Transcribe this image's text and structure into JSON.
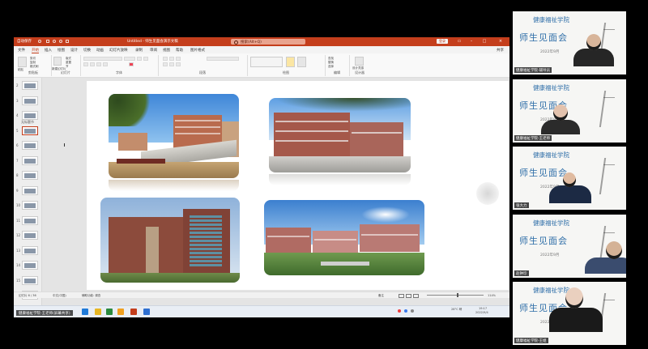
{
  "window": {
    "title_left": "自动保存",
    "doc_title": "Untitled - 师生见面会演示文稿",
    "search_placeholder": "搜索(Alt+Q)",
    "login": "登录",
    "share": "共享"
  },
  "tabs": [
    "文件",
    "开始",
    "插入",
    "绘图",
    "设计",
    "切换",
    "动画",
    "幻灯片放映",
    "录制",
    "审阅",
    "视图",
    "帮助",
    "图片格式"
  ],
  "active_tab": 1,
  "ribbon": {
    "groups": [
      "剪贴板",
      "幻灯片",
      "字体",
      "段落",
      "绘图",
      "编辑",
      "设计器"
    ],
    "clipboard": {
      "paste": "粘贴",
      "cut": "剪切",
      "copy": "复制",
      "format_painter": "格式刷"
    },
    "slides": {
      "new_slide": "新建幻灯片",
      "layout": "版式",
      "reset": "重置",
      "section": "节"
    },
    "editing": {
      "find": "查找",
      "replace": "替换",
      "select": "选择"
    },
    "designer": {
      "design_ideas": "设计灵感"
    }
  },
  "thumbnails": {
    "numbers": [
      "2",
      "3",
      "4",
      "5",
      "6",
      "7",
      "8",
      "9",
      "10",
      "11",
      "12",
      "13",
      "14",
      "15",
      "16"
    ],
    "section_label": "无标题节",
    "selected_index": 3
  },
  "status": {
    "slide_info": "幻灯片 6 / 36",
    "language": "中文(中国)",
    "accessibility": "辅助功能: 调查",
    "notes": "备注",
    "zoom": "114%"
  },
  "taskbar": {
    "time": "19:17",
    "date": "2022/9/4",
    "weather": "28°C 晴"
  },
  "slide_photos": [
    "campus-gate-photo",
    "main-building-photo",
    "library-photo",
    "campus-overview-photo"
  ],
  "video_tiles": [
    {
      "school": "健康福祉学院",
      "meeting": "师生见面会",
      "date": "2022年9月",
      "name": "健康福祉学院-辅导员"
    },
    {
      "school": "健康福祉学院",
      "meeting": "师生见面会",
      "date": "2022年9月",
      "name": "健康福祉学院-王老师"
    },
    {
      "school": "健康福祉学院",
      "meeting": "师生见面会",
      "date": "2022年9月",
      "name": "张大力"
    },
    {
      "school": "健康福祉学院",
      "meeting": "师生见面会",
      "date": "2022年9月",
      "name": "赵钟珍"
    },
    {
      "school": "健康福祉学院",
      "meeting": "师生见面会",
      "date": "2022年9月",
      "name": "健康福祉学院-王姐"
    }
  ],
  "presenter_label": "健康福祉学院-王老师(屏幕共享)",
  "colors": {
    "ppt_accent": "#c43e1c",
    "tile_text": "#2e6ea8"
  }
}
